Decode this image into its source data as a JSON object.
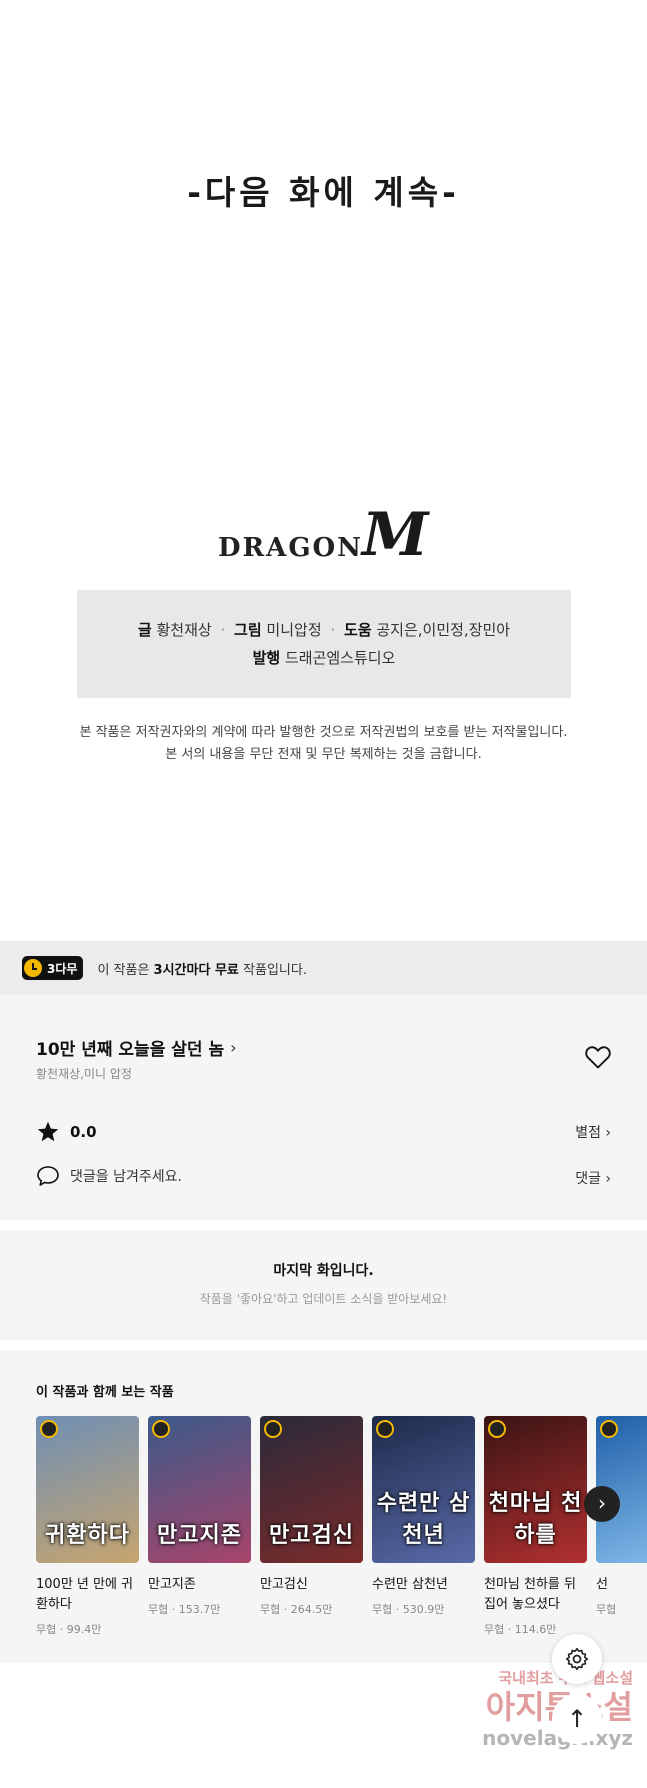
{
  "episode_end": {
    "continue_text": "-다음 화에 계속-",
    "logo_text": "DRAGON",
    "logo_m": "M"
  },
  "credits": {
    "writer_label": "글",
    "writer": "황천재상",
    "artist_label": "그림",
    "artist": "미니압정",
    "assist_label": "도움",
    "assist": "공지은,이민정,장민아",
    "publisher_label": "발행",
    "publisher": "드래곤엠스튜디오",
    "separator": "·"
  },
  "copyright": {
    "line1": "본 작품은 저작권자와의 계약에 따라 발행한 것으로 저작권법의 보호를 받는 저작물입니다.",
    "line2": "본 서의 내용을 무단 전재 및 무단 복제하는 것을 금합니다."
  },
  "free_banner": {
    "badge": "3다무",
    "text_prefix": "이 작품은 ",
    "text_bold": "3시간마다 무료",
    "text_suffix": " 작품입니다."
  },
  "work": {
    "title": "10만 년째 오늘을 살던 놈",
    "title_chevron": "›",
    "authors": "황천재상,미니 압정",
    "rating": "0.0",
    "rating_link": "별점 ›",
    "comment_placeholder": "댓글을 남겨주세요.",
    "comment_link": "댓글 ›"
  },
  "last_episode": {
    "title": "마지막 화입니다.",
    "subtitle": "작품을 '좋아요'하고 업데이트 소식을 받아보세요!"
  },
  "recommendations": {
    "heading": "이 작품과 함께 보는 작품",
    "items": [
      {
        "title": "100만 년 만에 귀환하다",
        "meta": "무협 · 99.4만",
        "cover_caption": "귀환하다",
        "color_a": "#6f8fb4",
        "color_b": "#c7a56e"
      },
      {
        "title": "만고지존",
        "meta": "무협 · 153.7만",
        "cover_caption": "만고지존",
        "color_a": "#3b5a8a",
        "color_b": "#a8446a"
      },
      {
        "title": "만고검신",
        "meta": "무협 · 264.5만",
        "cover_caption": "만고검신",
        "color_a": "#2a2a3a",
        "color_b": "#7a2b2b"
      },
      {
        "title": "수련만 삼천년",
        "meta": "무협 · 530.9만",
        "cover_caption": "수련만 삼천년",
        "color_a": "#1e2a4a",
        "color_b": "#5a6aa8"
      },
      {
        "title": "천마님 천하를 뒤집어 놓으셨다",
        "meta": "무협 · 114.6만",
        "cover_caption": "천마님 천하를",
        "color_a": "#3a1414",
        "color_b": "#b23030"
      },
      {
        "title": "선",
        "meta": "무협",
        "cover_caption": "",
        "color_a": "#1f5fa8",
        "color_b": "#88c0ee"
      }
    ],
    "next_icon": "›"
  },
  "floating": {
    "settings_icon": "gear-icon",
    "top_icon": "↑"
  },
  "watermark": {
    "line1": "국내최초 무료 웹소설",
    "line2": "아지툰소설",
    "line3": "novelagit.xyz"
  }
}
